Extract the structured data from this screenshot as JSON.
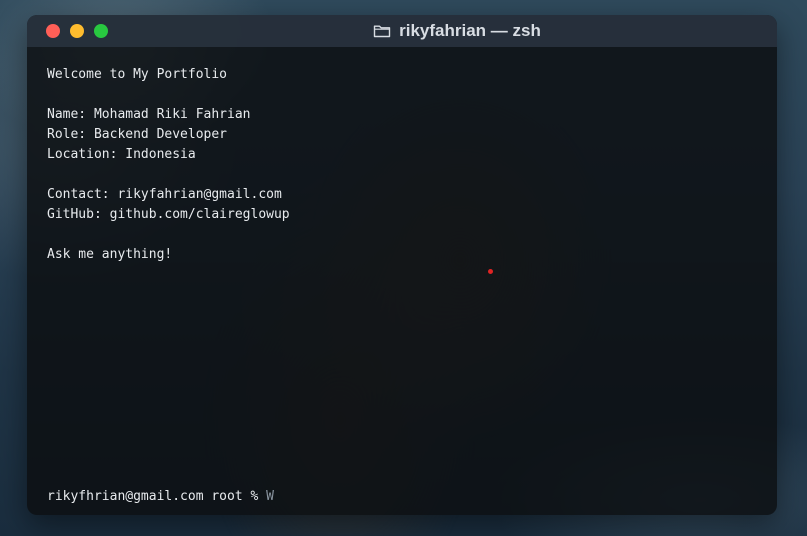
{
  "window": {
    "title": "rikyfahrian — zsh",
    "folder_icon": "folder-icon"
  },
  "terminal": {
    "welcome": "Welcome to My Portfolio",
    "name": "Name: Mohamad Riki Fahrian",
    "role": "Role: Backend Developer",
    "location": "Location: Indonesia",
    "contact": "Contact: rikyfahrian@gmail.com",
    "github": "GitHub: github.com/claireglowup",
    "ask": "Ask me anything!"
  },
  "prompt": {
    "text": "rikyfhrian@gmail.com root % ",
    "input": "W"
  },
  "colors": {
    "close": "#ff5f57",
    "minimize": "#febc2e",
    "maximize": "#28c840",
    "cursor_dot": "#e02424"
  }
}
